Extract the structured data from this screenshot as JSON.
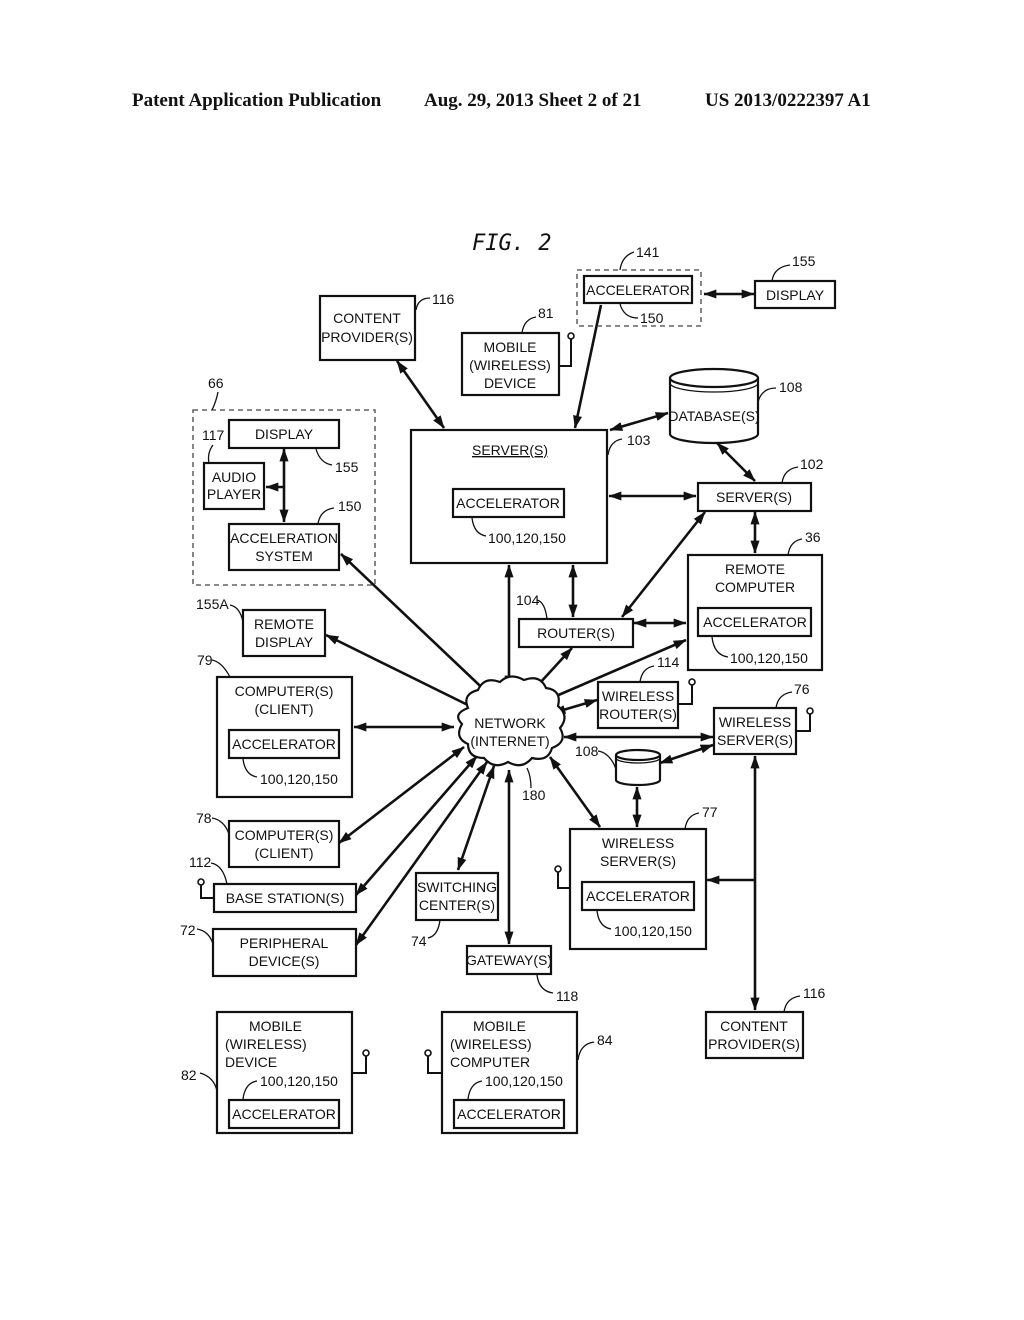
{
  "header": {
    "publication": "Patent Application Publication",
    "date_sheet": "Aug. 29, 2013  Sheet 2 of 21",
    "number": "US 2013/0222397 A1"
  },
  "figure": {
    "title": "FIG. 2",
    "nodes": {
      "accel141": {
        "label": "ACCELERATOR",
        "ref": "150",
        "group_ref": "141"
      },
      "display155": {
        "label": "DISPLAY",
        "ref": "155"
      },
      "content116top": {
        "line1": "CONTENT",
        "line2": "PROVIDER(S)",
        "ref": "116"
      },
      "mobile81": {
        "line1": "MOBILE",
        "line2": "(WIRELESS)",
        "line3": "DEVICE",
        "ref": "81"
      },
      "group66": {
        "ref": "66"
      },
      "display66": {
        "label": "DISPLAY",
        "ref": "155"
      },
      "audio": {
        "line1": "AUDIO",
        "line2": "PLAYER",
        "ref": "117"
      },
      "accsys": {
        "line1": "ACCELERATION",
        "line2": "SYSTEM",
        "ref": "150"
      },
      "server103": {
        "label": "SERVER(S)",
        "inner": "ACCELERATOR",
        "inner_ref": "100,120,150",
        "ref": "103"
      },
      "database108": {
        "label": "DATABASE(S)",
        "ref": "108"
      },
      "server102": {
        "label": "SERVER(S)",
        "ref": "102"
      },
      "remote36": {
        "line1": "REMOTE",
        "line2": "COMPUTER",
        "inner": "ACCELERATOR",
        "inner_ref": "100,120,150",
        "ref": "36"
      },
      "router104": {
        "label": "ROUTER(S)",
        "ref": "104"
      },
      "remotedisp": {
        "line1": "REMOTE",
        "line2": "DISPLAY",
        "ref": "155A"
      },
      "client79": {
        "line1": "COMPUTER(S)",
        "line2": "(CLIENT)",
        "inner": "ACCELERATOR",
        "inner_ref": "100,120,150",
        "ref": "79"
      },
      "network": {
        "line1": "NETWORK",
        "line2": "(INTERNET)",
        "ref": "180"
      },
      "wrouter114": {
        "line1": "WIRELESS",
        "line2": "ROUTER(S)",
        "ref": "114"
      },
      "wserver76": {
        "line1": "WIRELESS",
        "line2": "SERVER(S)",
        "ref": "76"
      },
      "db108small": {
        "ref": "108"
      },
      "wserver77": {
        "line1": "WIRELESS",
        "line2": "SERVER(S)",
        "inner": "ACCELERATOR",
        "inner_ref": "100,120,150",
        "ref": "77"
      },
      "client78": {
        "line1": "COMPUTER(S)",
        "line2": "(CLIENT)",
        "ref": "78"
      },
      "base112": {
        "label": "BASE STATION(S)",
        "ref": "112"
      },
      "periph72": {
        "line1": "PERIPHERAL",
        "line2": "DEVICE(S)",
        "ref": "72"
      },
      "switch74": {
        "line1": "SWITCHING",
        "line2": "CENTER(S)",
        "ref": "74"
      },
      "gateway118": {
        "label": "GATEWAY(S)",
        "ref": "118"
      },
      "content116bot": {
        "line1": "CONTENT",
        "line2": "PROVIDER(S)",
        "ref": "116"
      },
      "mobile82": {
        "line1": "MOBILE",
        "line2": "(WIRELESS)",
        "line3": "DEVICE",
        "inner": "ACCELERATOR",
        "inner_ref": "100,120,150",
        "ref": "82"
      },
      "mobile84": {
        "line1": "MOBILE",
        "line2": "(WIRELESS)",
        "line3": "COMPUTER",
        "inner": "ACCELERATOR",
        "inner_ref": "100,120,150",
        "ref": "84"
      }
    }
  }
}
